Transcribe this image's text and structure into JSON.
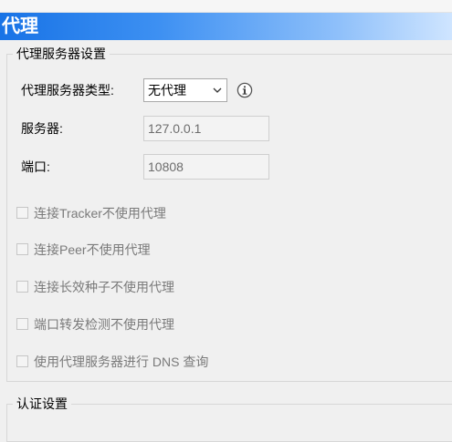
{
  "section": {
    "title": "代理"
  },
  "proxy_group": {
    "legend": "代理服务器设置",
    "type_label": "代理服务器类型:",
    "type_value": "无代理",
    "server_label": "服务器:",
    "server_value": "127.0.0.1",
    "port_label": "端口:",
    "port_value": "10808",
    "checkboxes": [
      {
        "label": "连接Tracker不使用代理",
        "checked": false
      },
      {
        "label": "连接Peer不使用代理",
        "checked": false
      },
      {
        "label": "连接长效种子不使用代理",
        "checked": false
      },
      {
        "label": "端口转发检测不使用代理",
        "checked": false
      },
      {
        "label": "使用代理服务器进行 DNS 查询",
        "checked": false
      }
    ]
  },
  "auth_group": {
    "legend": "认证设置"
  },
  "icons": {
    "dropdown": "chevron-down-icon",
    "info": "info-icon"
  },
  "colors": {
    "header_start": "#1873e6",
    "header_end": "#cfe5ff",
    "disabled_text": "#7a7a7a"
  }
}
